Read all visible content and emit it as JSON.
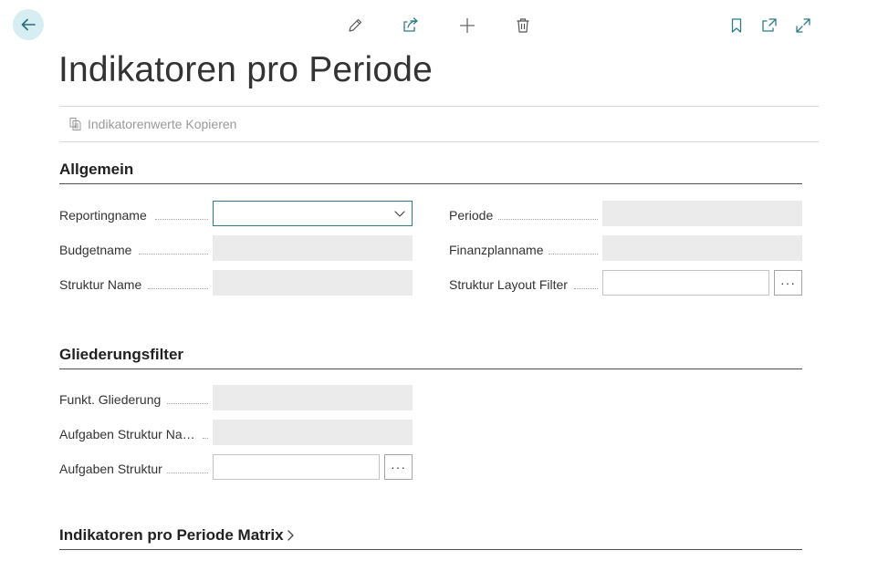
{
  "page": {
    "title": "Indikatoren pro Periode"
  },
  "toolbar": {
    "back": "back-arrow-icon",
    "edit": "pencil-icon",
    "share": "share-icon",
    "new": "plus-icon",
    "delete": "trash-icon",
    "bookmark": "bookmark-icon",
    "open_new_window": "open-in-new-icon",
    "expand": "expand-icon"
  },
  "actions": [
    {
      "label": "Indikatorenwerte Kopieren",
      "icon": "copy-icon"
    }
  ],
  "sections": {
    "allgemein": {
      "title": "Allgemein",
      "fields": {
        "reportingname": {
          "label": "Reportingname",
          "value": ""
        },
        "budgetname": {
          "label": "Budgetname",
          "value": ""
        },
        "struktur_name": {
          "label": "Struktur Name",
          "value": ""
        },
        "periode": {
          "label": "Periode",
          "value": ""
        },
        "finanzplanname": {
          "label": "Finanzplanname",
          "value": ""
        },
        "struktur_layout_filter": {
          "label": "Struktur Layout Filter",
          "value": ""
        }
      }
    },
    "gliederungsfilter": {
      "title": "Gliederungsfilter",
      "fields": {
        "funkt_gliederung": {
          "label": "Funkt. Gliederung",
          "value": ""
        },
        "aufgaben_struktur_name": {
          "label": "Aufgaben Struktur Na…",
          "value": ""
        },
        "aufgaben_struktur": {
          "label": "Aufgaben Struktur",
          "value": ""
        }
      }
    },
    "matrix": {
      "title": "Indikatoren pro Periode Matrix"
    }
  },
  "ellipsis_label": "···",
  "colors": {
    "accent": "#2d7c86",
    "back_bg": "#d6eef1",
    "readonly_bg": "#ebebeb"
  }
}
